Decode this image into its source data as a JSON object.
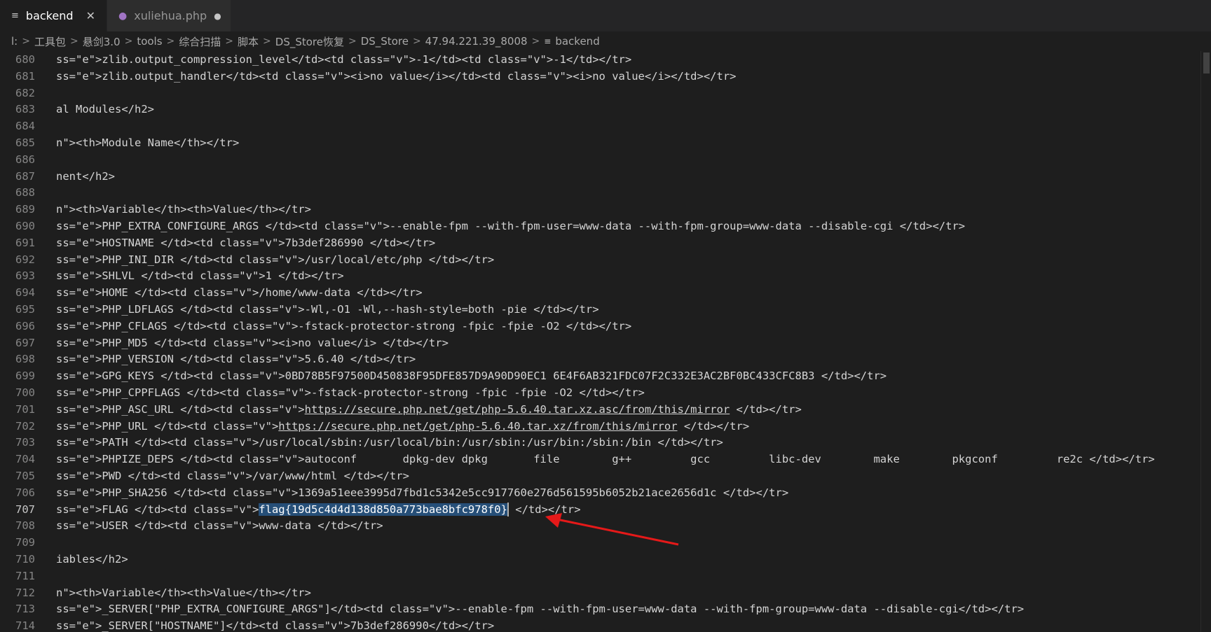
{
  "tabs": [
    {
      "label": "backend",
      "icon": "file-lines-icon",
      "active": true,
      "close": "✕"
    },
    {
      "label": "xuliehua.php",
      "icon": "php-elephant-icon",
      "active": false,
      "dirty": "●"
    }
  ],
  "breadcrumb": [
    "l:",
    "工具包",
    "悬剑3.0",
    "tools",
    "综合扫描",
    "脚本",
    "DS_Store恢复",
    "DS_Store",
    "47.94.221.39_8008",
    "backend"
  ],
  "editor": {
    "current_line": "707",
    "lines": [
      {
        "n": "680",
        "code": "ss=\"e\">zlib.output_compression_level</td><td class=\"v\">-1</td><td class=\"v\">-1</td></tr>"
      },
      {
        "n": "681",
        "code": "ss=\"e\">zlib.output_handler</td><td class=\"v\"><i>no value</i></td><td class=\"v\"><i>no value</i></td></tr>"
      },
      {
        "n": "682",
        "code": ""
      },
      {
        "n": "683",
        "code": "al Modules</h2>"
      },
      {
        "n": "684",
        "code": ""
      },
      {
        "n": "685",
        "code": "n\"><th>Module Name</th></tr>"
      },
      {
        "n": "686",
        "code": ""
      },
      {
        "n": "687",
        "code": "nent</h2>"
      },
      {
        "n": "688",
        "code": ""
      },
      {
        "n": "689",
        "code": "n\"><th>Variable</th><th>Value</th></tr>"
      },
      {
        "n": "690",
        "code": "ss=\"e\">PHP_EXTRA_CONFIGURE_ARGS </td><td class=\"v\">--enable-fpm --with-fpm-user=www-data --with-fpm-group=www-data --disable-cgi </td></tr>"
      },
      {
        "n": "691",
        "code": "ss=\"e\">HOSTNAME </td><td class=\"v\">7b3def286990 </td></tr>"
      },
      {
        "n": "692",
        "code": "ss=\"e\">PHP_INI_DIR </td><td class=\"v\">/usr/local/etc/php </td></tr>"
      },
      {
        "n": "693",
        "code": "ss=\"e\">SHLVL </td><td class=\"v\">1 </td></tr>"
      },
      {
        "n": "694",
        "code": "ss=\"e\">HOME </td><td class=\"v\">/home/www-data </td></tr>"
      },
      {
        "n": "695",
        "code": "ss=\"e\">PHP_LDFLAGS </td><td class=\"v\">-Wl,-O1 -Wl,--hash-style=both -pie </td></tr>"
      },
      {
        "n": "696",
        "code": "ss=\"e\">PHP_CFLAGS </td><td class=\"v\">-fstack-protector-strong -fpic -fpie -O2 </td></tr>"
      },
      {
        "n": "697",
        "code": "ss=\"e\">PHP_MD5 </td><td class=\"v\"><i>no value</i> </td></tr>"
      },
      {
        "n": "698",
        "code": "ss=\"e\">PHP_VERSION </td><td class=\"v\">5.6.40 </td></tr>"
      },
      {
        "n": "699",
        "code": "ss=\"e\">GPG_KEYS </td><td class=\"v\">0BD78B5F97500D450838F95DFE857D9A90D90EC1 6E4F6AB321FDC07F2C332E3AC2BF0BC433CFC8B3 </td></tr>"
      },
      {
        "n": "700",
        "code": "ss=\"e\">PHP_CPPFLAGS </td><td class=\"v\">-fstack-protector-strong -fpic -fpie -O2 </td></tr>"
      },
      {
        "n": "701",
        "pre": "ss=\"e\">PHP_ASC_URL </td><td class=\"v\">",
        "link": "https://secure.php.net/get/php-5.6.40.tar.xz.asc/from/this/mirror",
        "post": " </td></tr>"
      },
      {
        "n": "702",
        "pre": "ss=\"e\">PHP_URL </td><td class=\"v\">",
        "link": "https://secure.php.net/get/php-5.6.40.tar.xz/from/this/mirror",
        "post": " </td></tr>"
      },
      {
        "n": "703",
        "code": "ss=\"e\">PATH </td><td class=\"v\">/usr/local/sbin:/usr/local/bin:/usr/sbin:/usr/bin:/sbin:/bin </td></tr>"
      },
      {
        "n": "704",
        "code": "ss=\"e\">PHPIZE_DEPS </td><td class=\"v\">autoconf       dpkg-dev dpkg       file        g++         gcc         libc-dev        make        pkgconf         re2c </td></tr>"
      },
      {
        "n": "705",
        "code": "ss=\"e\">PWD </td><td class=\"v\">/var/www/html </td></tr>"
      },
      {
        "n": "706",
        "code": "ss=\"e\">PHP_SHA256 </td><td class=\"v\">1369a51eee3995d7fbd1c5342e5cc917760e276d561595b6052b21ace2656d1c </td></tr>"
      },
      {
        "n": "707",
        "pre": "ss=\"e\">FLAG </td><td class=\"v\">",
        "flag": "flag{19d5c4d4d138d850a773bae8bfc978f0}",
        "post": " </td></tr>"
      },
      {
        "n": "708",
        "code": "ss=\"e\">USER </td><td class=\"v\">www-data </td></tr>"
      },
      {
        "n": "709",
        "code": ""
      },
      {
        "n": "710",
        "code": "iables</h2>"
      },
      {
        "n": "711",
        "code": ""
      },
      {
        "n": "712",
        "code": "n\"><th>Variable</th><th>Value</th></tr>"
      },
      {
        "n": "713",
        "code": "ss=\"e\">_SERVER[\"PHP_EXTRA_CONFIGURE_ARGS\"]</td><td class=\"v\">--enable-fpm --with-fpm-user=www-data --with-fpm-group=www-data --disable-cgi</td></tr>"
      },
      {
        "n": "714",
        "code": "ss=\"e\">_SERVER[\"HOSTNAME\"]</td><td class=\"v\">7b3def286990</td></tr>"
      }
    ]
  },
  "annotation": {
    "color": "#e51919"
  }
}
